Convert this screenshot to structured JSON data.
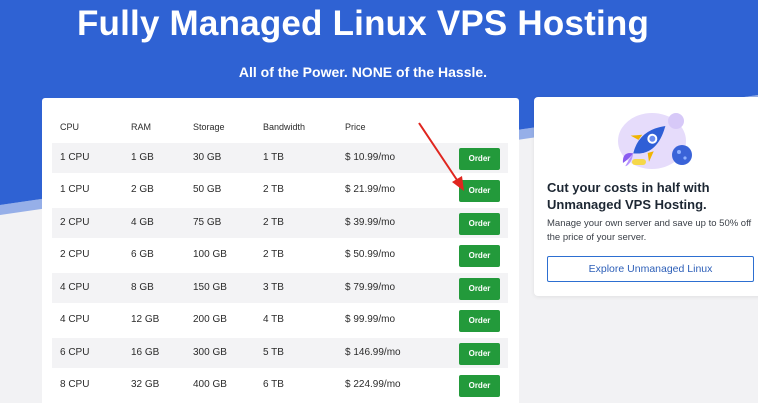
{
  "hero": {
    "title": "Fully Managed Linux VPS Hosting",
    "subtitle": "All of the Power. NONE of the Hassle."
  },
  "table": {
    "headers": {
      "cpu": "CPU",
      "ram": "RAM",
      "storage": "Storage",
      "bandwidth": "Bandwidth",
      "price": "Price"
    },
    "rows": [
      {
        "cpu": "1 CPU",
        "ram": "1 GB",
        "storage": "30 GB",
        "bandwidth": "1 TB",
        "price": "$ 10.99/mo",
        "action": "Order"
      },
      {
        "cpu": "1 CPU",
        "ram": "2 GB",
        "storage": "50 GB",
        "bandwidth": "2 TB",
        "price": "$ 21.99/mo",
        "action": "Order"
      },
      {
        "cpu": "2 CPU",
        "ram": "4 GB",
        "storage": "75 GB",
        "bandwidth": "2 TB",
        "price": "$ 39.99/mo",
        "action": "Order"
      },
      {
        "cpu": "2 CPU",
        "ram": "6 GB",
        "storage": "100 GB",
        "bandwidth": "2 TB",
        "price": "$ 50.99/mo",
        "action": "Order"
      },
      {
        "cpu": "4 CPU",
        "ram": "8 GB",
        "storage": "150 GB",
        "bandwidth": "3 TB",
        "price": "$ 79.99/mo",
        "action": "Order"
      },
      {
        "cpu": "4 CPU",
        "ram": "12 GB",
        "storage": "200 GB",
        "bandwidth": "4 TB",
        "price": "$ 99.99/mo",
        "action": "Order"
      },
      {
        "cpu": "6 CPU",
        "ram": "16 GB",
        "storage": "300 GB",
        "bandwidth": "5 TB",
        "price": "$ 146.99/mo",
        "action": "Order"
      },
      {
        "cpu": "8 CPU",
        "ram": "32 GB",
        "storage": "400 GB",
        "bandwidth": "6 TB",
        "price": "$ 224.99/mo",
        "action": "Order"
      }
    ]
  },
  "promo": {
    "heading": "Cut your costs in half with Unmanaged VPS Hosting.",
    "text": "Manage your own server and save up to 50% off the price of your server.",
    "button_label": "Explore Unmanaged Linux",
    "illustration_icon": "rocket-icon"
  },
  "colors": {
    "hero_blue": "#2f62d3",
    "order_green": "#239a3b",
    "annotation_red": "#e0261f",
    "promo_button_border": "#2d6fd1"
  }
}
